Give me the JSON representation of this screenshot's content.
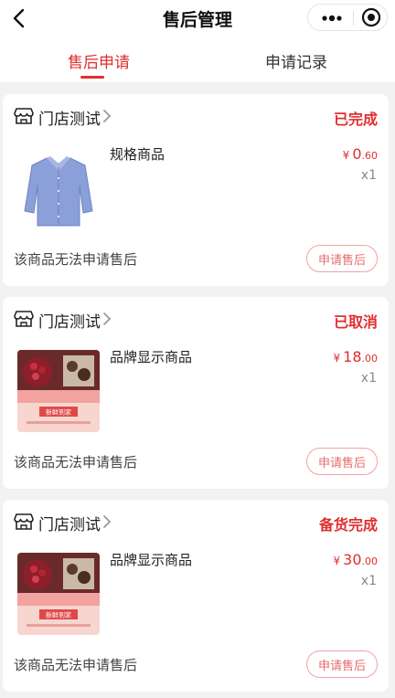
{
  "header": {
    "title": "售后管理"
  },
  "tabs": [
    {
      "label": "售后申请"
    },
    {
      "label": "申请记录"
    }
  ],
  "orders": [
    {
      "store": "门店测试",
      "status": "已完成",
      "product": {
        "name": "规格商品",
        "image": "blue-shirt",
        "currency": "¥",
        "price_int": "0",
        "price_dec": ".60",
        "qty": "x1"
      },
      "note": "该商品无法申请售后",
      "button": "申请售后"
    },
    {
      "store": "门店测试",
      "status": "已取消",
      "product": {
        "name": "品牌显示商品",
        "image": "dessert-promo",
        "currency": "¥",
        "price_int": "18",
        "price_dec": ".00",
        "qty": "x1",
        "image_text": {
          "caption": "新鲜到家"
        }
      },
      "note": "该商品无法申请售后",
      "button": "申请售后"
    },
    {
      "store": "门店测试",
      "status": "备货完成",
      "product": {
        "name": "品牌显示商品",
        "image": "dessert-promo",
        "currency": "¥",
        "price_int": "30",
        "price_dec": ".00",
        "qty": "x1",
        "image_text": {
          "caption": "新鲜到家"
        }
      },
      "note": "该商品无法申请售后",
      "button": "申请售后"
    }
  ],
  "icons": {
    "back": "chevron-left-icon",
    "more": "more-dots-icon",
    "target": "target-icon",
    "store": "store-icon",
    "chevron": "chevron-right-icon"
  },
  "colors": {
    "accent": "#e02e2e",
    "button_border": "#f0a3a3",
    "background": "#f2f2f2"
  }
}
